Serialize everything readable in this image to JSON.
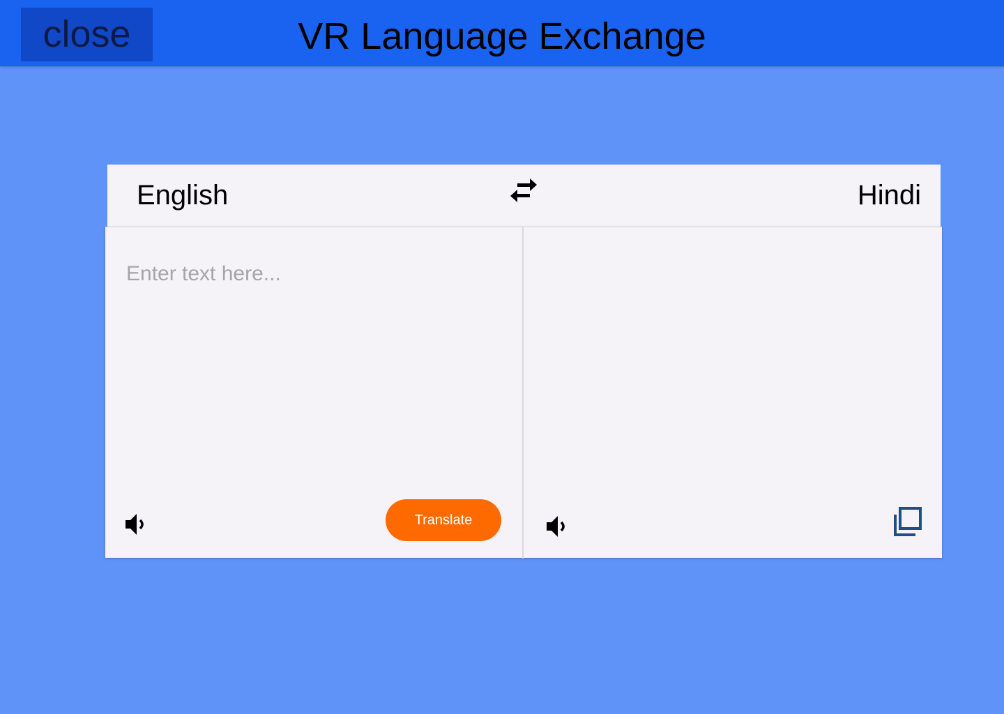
{
  "header": {
    "close_label": "close",
    "title": "VR Language Exchange"
  },
  "languages": {
    "source": "English",
    "target": "Hindi",
    "swap_icon": "swap-arrows-icon"
  },
  "source_panel": {
    "input_value": "",
    "placeholder": "Enter text here...",
    "speaker_icon": "speaker-icon",
    "translate_label": "Translate"
  },
  "target_panel": {
    "output_value": "",
    "speaker_icon": "speaker-icon",
    "copy_icon": "copy-icon"
  },
  "colors": {
    "background": "#5f93f7",
    "header": "#1a63f0",
    "close_button": "#1148c7",
    "panel": "#f5f2f8",
    "translate_button": "#ff6a00",
    "copy_icon": "#1f4f86"
  }
}
